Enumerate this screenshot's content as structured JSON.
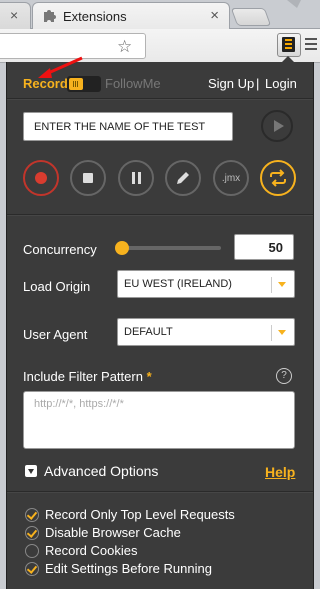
{
  "browser": {
    "tab_title": "Extensions",
    "tab_close": "×",
    "prev_tab_close": "×",
    "star": "☆"
  },
  "header": {
    "record": "Record",
    "followme": "FollowMe",
    "signup": "Sign Up",
    "separator": "|",
    "login": "Login"
  },
  "test": {
    "name_placeholder": "ENTER THE NAME OF THE TEST"
  },
  "controls": {
    "jmx_label": ".jmx"
  },
  "settings": {
    "concurrency_label": "Concurrency",
    "concurrency_value": "50",
    "concurrency_level": 0.0,
    "load_origin_label": "Load Origin",
    "load_origin_value": "EU WEST (IRELAND)",
    "user_agent_label": "User Agent",
    "user_agent_value": "DEFAULT",
    "filter_label": "Include Filter Pattern",
    "filter_required": "*",
    "filter_help": "?",
    "filter_placeholder": "http://*/*, https://*/*"
  },
  "advanced": {
    "label": "Advanced Options",
    "help": "Help"
  },
  "options": [
    {
      "label": "Record Only Top Level Requests",
      "checked": true
    },
    {
      "label": "Disable Browser Cache",
      "checked": true
    },
    {
      "label": "Record Cookies",
      "checked": false
    },
    {
      "label": "Edit Settings Before Running",
      "checked": true
    }
  ],
  "colors": {
    "accent": "#f7b21e",
    "panel_bg": "#3b3b3b",
    "record_red": "#d93c2f"
  }
}
